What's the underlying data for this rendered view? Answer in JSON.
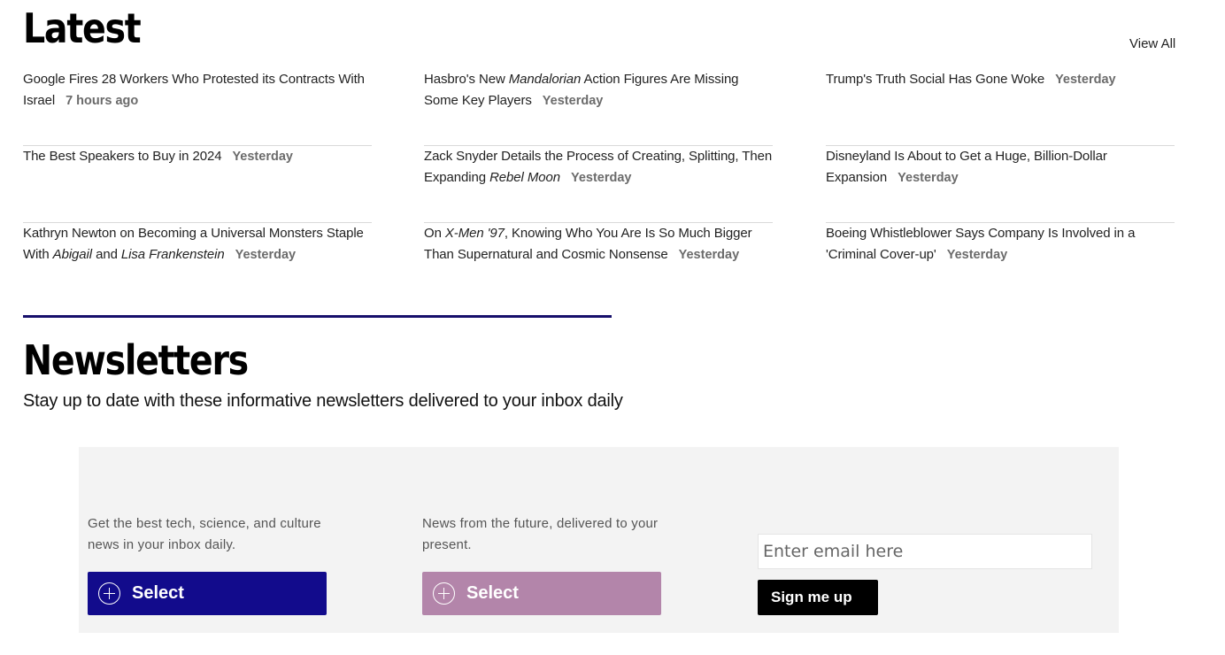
{
  "latest": {
    "title": "Latest",
    "view_all": "View All",
    "columns": [
      [
        {
          "parts": [
            {
              "t": "Google Fires 28 Workers Who Protested its Contracts With Israel"
            }
          ],
          "time": "7 hours ago"
        },
        {
          "parts": [
            {
              "t": "The Best Speakers to Buy in 2024"
            }
          ],
          "time": "Yesterday"
        },
        {
          "parts": [
            {
              "t": "Kathryn Newton on Becoming a Universal Monsters Staple With "
            },
            {
              "t": "Abigail",
              "i": true
            },
            {
              "t": " and "
            },
            {
              "t": "Lisa Frankenstein",
              "i": true
            }
          ],
          "time": "Yesterday"
        }
      ],
      [
        {
          "parts": [
            {
              "t": "Hasbro's New "
            },
            {
              "t": "Mandalorian",
              "i": true
            },
            {
              "t": " Action Figures Are Missing Some Key Players"
            }
          ],
          "time": "Yesterday"
        },
        {
          "parts": [
            {
              "t": "Zack Snyder Details the Process of Creating, Splitting, Then Expanding "
            },
            {
              "t": "Rebel Moon",
              "i": true
            }
          ],
          "time": "Yesterday"
        },
        {
          "parts": [
            {
              "t": "On "
            },
            {
              "t": "X-Men '97",
              "i": true
            },
            {
              "t": ", Knowing Who You Are Is So Much Bigger Than Supernatural and Cosmic Nonsense"
            }
          ],
          "time": "Yesterday"
        }
      ],
      [
        {
          "parts": [
            {
              "t": "Trump's Truth Social Has Gone Woke"
            }
          ],
          "time": "Yesterday"
        },
        {
          "parts": [
            {
              "t": "Disneyland Is About to Get a Huge, Billion-Dollar Expansion"
            }
          ],
          "time": "Yesterday"
        },
        {
          "parts": [
            {
              "t": "Boeing Whistleblower Says Company Is Involved in a 'Criminal Cover-up'"
            }
          ],
          "time": "Yesterday"
        }
      ]
    ]
  },
  "newsletters": {
    "title": "Newsletters",
    "subtitle": "Stay up to date with these informative newsletters delivered to your inbox daily",
    "items": [
      {
        "description": "Get the best tech, science, and culture news in your inbox daily.",
        "button_label": "Select",
        "color": "#120b8c"
      },
      {
        "description": "News from the future, delivered to your present.",
        "button_label": "Select",
        "color": "#b385aa"
      }
    ],
    "email_placeholder": "Enter email here",
    "email_value": "",
    "signup_label": "Sign me up"
  },
  "colors": {
    "accent_divider": "#160f6b",
    "time_text": "#6b6b6b",
    "signup_bg": "#f3f3f3"
  }
}
